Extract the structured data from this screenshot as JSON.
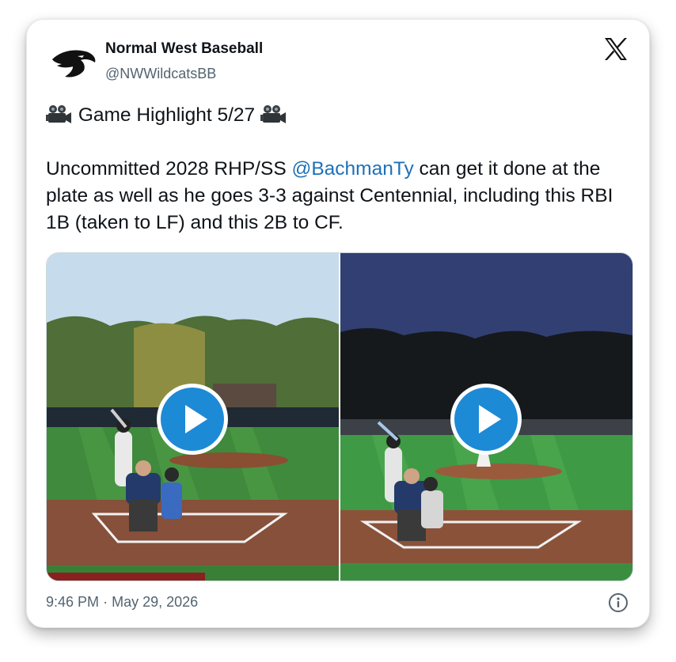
{
  "account": {
    "display_name": "Normal West Baseball",
    "handle": "@NWWildcatsBB",
    "avatar_icon": "wildcat-logo-icon"
  },
  "platform_icon": "x-logo-icon",
  "tweet": {
    "line1_text": "Game Highlight 5/27",
    "line1_icon": "movie-camera-icon",
    "body_before_mention": "Uncommitted 2028 RHP/SS ",
    "mention": "@BachmanTy",
    "body_after_mention": " can get it done at the plate as well as he goes 3-3 against Centennial, including this RBI 1B (taken to LF) and this 2B to CF."
  },
  "media": {
    "clips": [
      {
        "name": "day-game-clip",
        "play_icon": "play-button-icon"
      },
      {
        "name": "night-game-clip",
        "play_icon": "play-button-icon"
      }
    ]
  },
  "footer": {
    "time": "9:46 PM",
    "separator": "·",
    "date": "May 29, 2026",
    "info_icon": "info-icon"
  },
  "colors": {
    "mention": "#1d70b8",
    "play_button": "#1d8ad6",
    "text": "#0f1419",
    "secondary_text": "#536471"
  }
}
